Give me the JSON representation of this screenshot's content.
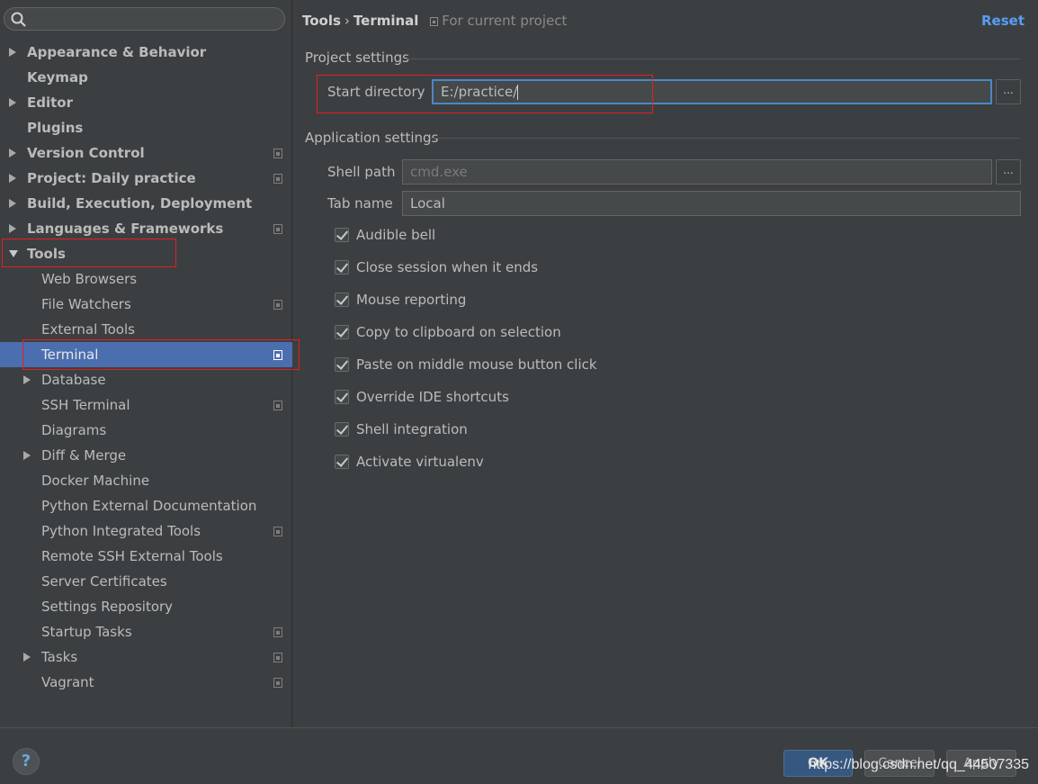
{
  "sidebar": {
    "search": {
      "placeholder": "",
      "value": ""
    },
    "items": [
      {
        "label": "Appearance & Behavior",
        "level": 0,
        "bold": true,
        "arrow": "right",
        "projectIcon": false
      },
      {
        "label": "Keymap",
        "level": 0,
        "bold": true,
        "arrow": "none",
        "projectIcon": false
      },
      {
        "label": "Editor",
        "level": 0,
        "bold": true,
        "arrow": "right",
        "projectIcon": false
      },
      {
        "label": "Plugins",
        "level": 0,
        "bold": true,
        "arrow": "none",
        "projectIcon": false
      },
      {
        "label": "Version Control",
        "level": 0,
        "bold": true,
        "arrow": "right",
        "projectIcon": true
      },
      {
        "label": "Project: Daily practice",
        "level": 0,
        "bold": true,
        "arrow": "right",
        "projectIcon": true
      },
      {
        "label": "Build, Execution, Deployment",
        "level": 0,
        "bold": true,
        "arrow": "right",
        "projectIcon": false
      },
      {
        "label": "Languages & Frameworks",
        "level": 0,
        "bold": true,
        "arrow": "right",
        "projectIcon": true
      },
      {
        "label": "Tools",
        "level": 0,
        "bold": true,
        "arrow": "down",
        "projectIcon": false
      },
      {
        "label": "Web Browsers",
        "level": 1,
        "bold": false,
        "arrow": "none",
        "projectIcon": false
      },
      {
        "label": "File Watchers",
        "level": 1,
        "bold": false,
        "arrow": "none",
        "projectIcon": true
      },
      {
        "label": "External Tools",
        "level": 1,
        "bold": false,
        "arrow": "none",
        "projectIcon": false
      },
      {
        "label": "Terminal",
        "level": 1,
        "bold": false,
        "arrow": "none",
        "projectIcon": true,
        "selected": true
      },
      {
        "label": "Database",
        "level": 1,
        "bold": false,
        "arrow": "right",
        "projectIcon": false
      },
      {
        "label": "SSH Terminal",
        "level": 1,
        "bold": false,
        "arrow": "none",
        "projectIcon": true
      },
      {
        "label": "Diagrams",
        "level": 1,
        "bold": false,
        "arrow": "none",
        "projectIcon": false
      },
      {
        "label": "Diff & Merge",
        "level": 1,
        "bold": false,
        "arrow": "right",
        "projectIcon": false
      },
      {
        "label": "Docker Machine",
        "level": 1,
        "bold": false,
        "arrow": "none",
        "projectIcon": false
      },
      {
        "label": "Python External Documentation",
        "level": 1,
        "bold": false,
        "arrow": "none",
        "projectIcon": false
      },
      {
        "label": "Python Integrated Tools",
        "level": 1,
        "bold": false,
        "arrow": "none",
        "projectIcon": true
      },
      {
        "label": "Remote SSH External Tools",
        "level": 1,
        "bold": false,
        "arrow": "none",
        "projectIcon": false
      },
      {
        "label": "Server Certificates",
        "level": 1,
        "bold": false,
        "arrow": "none",
        "projectIcon": false
      },
      {
        "label": "Settings Repository",
        "level": 1,
        "bold": false,
        "arrow": "none",
        "projectIcon": false
      },
      {
        "label": "Startup Tasks",
        "level": 1,
        "bold": false,
        "arrow": "none",
        "projectIcon": true
      },
      {
        "label": "Tasks",
        "level": 1,
        "bold": false,
        "arrow": "right",
        "projectIcon": true
      },
      {
        "label": "Vagrant",
        "level": 1,
        "bold": false,
        "arrow": "none",
        "projectIcon": true
      }
    ]
  },
  "header": {
    "crumb_parent": "Tools",
    "crumb_sep": "›",
    "crumb_current": "Terminal",
    "scope": "For current project",
    "reset": "Reset"
  },
  "project_settings": {
    "title": "Project settings",
    "start_directory_label": "Start directory",
    "start_directory_value": "E:/practice/",
    "browse_label": "..."
  },
  "application_settings": {
    "title": "Application settings",
    "shell_path_label": "Shell path",
    "shell_path_placeholder": "cmd.exe",
    "tab_name_label": "Tab name",
    "tab_name_value": "Local",
    "browse_label": "...",
    "checkboxes": [
      {
        "label": "Audible bell",
        "checked": true
      },
      {
        "label": "Close session when it ends",
        "checked": true
      },
      {
        "label": "Mouse reporting",
        "checked": true
      },
      {
        "label": "Copy to clipboard on selection",
        "checked": true
      },
      {
        "label": "Paste on middle mouse button click",
        "checked": true
      },
      {
        "label": "Override IDE shortcuts",
        "checked": true
      },
      {
        "label": "Shell integration",
        "checked": true
      },
      {
        "label": "Activate virtualenv",
        "checked": true
      }
    ]
  },
  "footer": {
    "help": "?",
    "ok": "OK",
    "cancel": "Cancel",
    "apply": "Apply",
    "watermark": "https://blog.csdn.net/qq_44507335"
  },
  "colors": {
    "background": "#3c3f41",
    "selection": "#4b6eaf",
    "link": "#589df6",
    "annotation": "#e81c23",
    "focus": "#4a88c7"
  }
}
